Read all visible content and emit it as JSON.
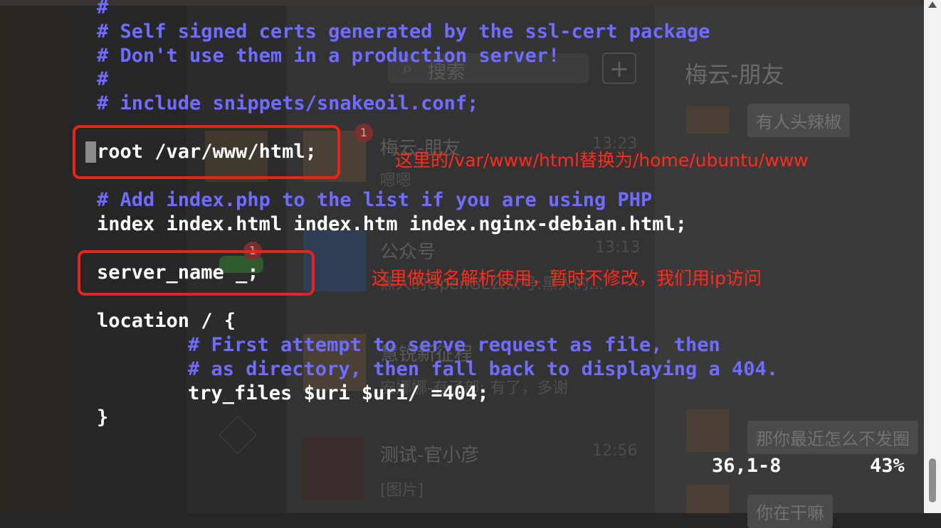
{
  "terminal": {
    "lines": [
      {
        "text": "#",
        "kind": "comment"
      },
      {
        "text": "# Self signed certs generated by the ssl-cert package",
        "kind": "comment"
      },
      {
        "text": "# Don't use them in a production server!",
        "kind": "comment"
      },
      {
        "text": "#",
        "kind": "comment"
      },
      {
        "text": "# include snippets/snakeoil.conf;",
        "kind": "comment"
      },
      {
        "text": "root /var/www/html;",
        "kind": "code"
      },
      {
        "text": "# Add index.php to the list if you are using PHP",
        "kind": "comment"
      },
      {
        "text": "index index.html index.htm index.nginx-debian.html;",
        "kind": "code"
      },
      {
        "text": "server_name _;",
        "kind": "code"
      },
      {
        "text": "location / {",
        "kind": "code"
      },
      {
        "text": "# First attempt to serve request as file, then",
        "kind": "comment"
      },
      {
        "text": "# as directory, then fall back to displaying a 404.",
        "kind": "comment"
      },
      {
        "text": "try_files $uri $uri/ =404;",
        "kind": "code"
      },
      {
        "text": "}",
        "kind": "code"
      }
    ],
    "status_position": "36,1-8",
    "status_percent": "43%"
  },
  "annotations": {
    "root_note": "这里的/var/www/html替换为/home/ubuntu/www",
    "server_name_note": "这里做域名解析使用，暂时不修改，我们用ip访问"
  },
  "background_app": {
    "search_placeholder": "搜索",
    "add_button": "+",
    "chat_title": "梅云-朋友",
    "conversations": [
      {
        "name": "梅云-朋友",
        "message": "嗯嗯",
        "time": "13:23",
        "badge": "1"
      },
      {
        "name": "公众号",
        "message": "黑人的OpenGL公众号:黑人的...",
        "time": "13:13",
        "badge": "1"
      },
      {
        "name": "慧锐新征程",
        "message": "安娜娜-有了部: 有了，多谢",
        "time": ""
      },
      {
        "name": "测试-官小彦",
        "message": "[图片]",
        "time": "12:56"
      }
    ],
    "bubbles": [
      "有人头辣椒",
      "那你最近怎么不发圈",
      "你在干嘛"
    ]
  },
  "colors": {
    "comment": "#6f6cff",
    "code": "#ffffff",
    "annotation": "#e8231b"
  }
}
